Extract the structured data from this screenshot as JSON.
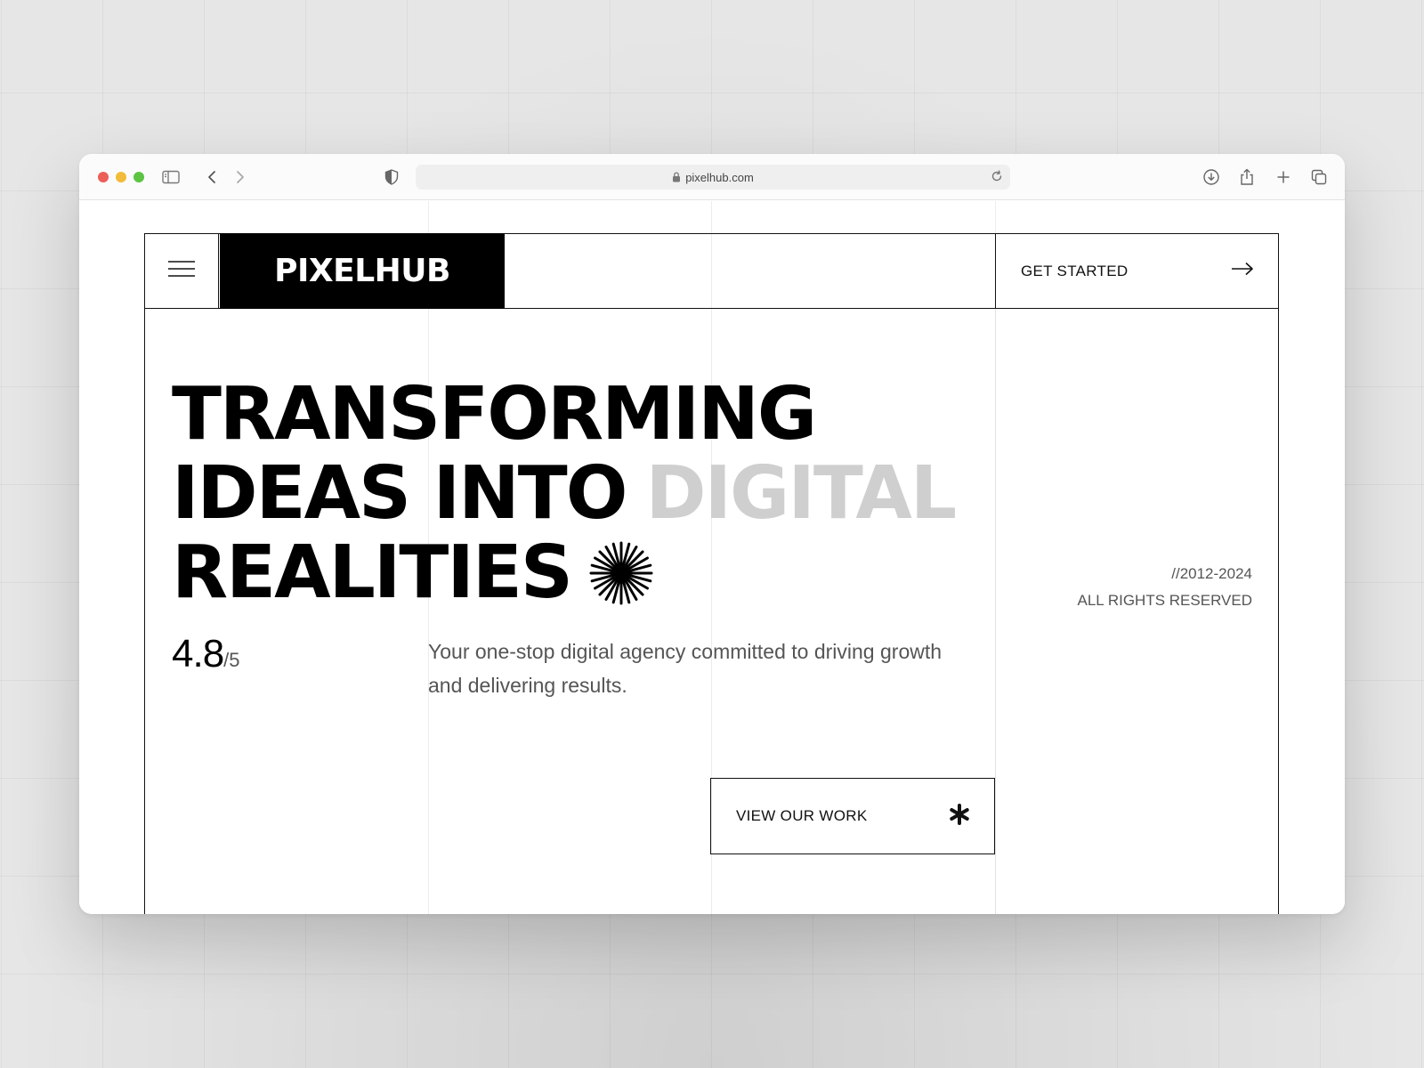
{
  "browser": {
    "url": "pixelhub.com",
    "traffic_lights": {
      "close": "#ec5f58",
      "minimize": "#f2bc3a",
      "zoom": "#5cc442"
    },
    "icons": [
      "sidebar-toggle-icon",
      "back-icon",
      "forward-icon",
      "shield-icon",
      "lock-icon",
      "reload-icon",
      "download-icon",
      "share-icon",
      "new-tab-icon",
      "tab-overview-icon"
    ]
  },
  "site": {
    "logo": "PIXELHUB",
    "menu_icon": "hamburger-menu-icon",
    "get_started": {
      "label": "GET STARTED",
      "icon": "arrow-right-icon"
    },
    "hero": {
      "line1": "TRANSFORMING",
      "line2_dark": "IDEAS INTO",
      "line2_light": "DIGITAL",
      "line3": "REALITIES",
      "decoration_icon": "starburst-icon",
      "accent_light": "#cfcfcf"
    },
    "rating": {
      "value": "4.8",
      "scale": "/5"
    },
    "tagline": "Your one-stop digital agency committed to driving growth and delivering results.",
    "copyright": {
      "years": "//2012-2024",
      "rights": "ALL RIGHTS RESERVED"
    },
    "view_work": {
      "label": "VIEW OUR WORK",
      "icon": "asterisk-icon"
    }
  }
}
